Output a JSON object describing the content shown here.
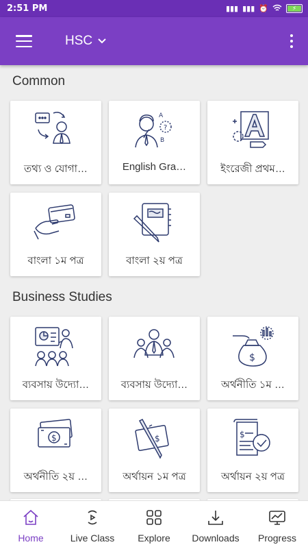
{
  "status_bar": {
    "time": "2:51 PM"
  },
  "appbar": {
    "title": "HSC"
  },
  "sections": [
    {
      "title": "Common",
      "cards": [
        {
          "label": "তথ্য ও যোগা…",
          "icon": "communication-icon"
        },
        {
          "label": "English Gra…",
          "icon": "thinking-person-icon"
        },
        {
          "label": "ইংরেজী প্রথম…",
          "icon": "letter-a-icon"
        },
        {
          "label": "বাংলা ১ম পত্র",
          "icon": "hand-card-icon"
        },
        {
          "label": "বাংলা ২য় পত্র",
          "icon": "notebook-pen-icon"
        }
      ]
    },
    {
      "title": "Business Studies",
      "cards": [
        {
          "label": "ব্যবসায় উদ্যো…",
          "icon": "presentation-icon"
        },
        {
          "label": "ব্যবসায় উদ্যো…",
          "icon": "team-icon"
        },
        {
          "label": "অর্থনীতি ১ম …",
          "icon": "money-bag-icon"
        },
        {
          "label": "অর্থনীতি ২য় …",
          "icon": "cash-icon"
        },
        {
          "label": "অর্থায়ন ১ম পত্র",
          "icon": "pen-money-icon"
        },
        {
          "label": "অর্থায়ন ২য় পত্র",
          "icon": "approved-document-icon"
        }
      ]
    }
  ],
  "bottom_nav": [
    {
      "label": "Home",
      "icon": "home-icon",
      "active": true
    },
    {
      "label": "Live Class",
      "icon": "live-icon"
    },
    {
      "label": "Explore",
      "icon": "grid-icon"
    },
    {
      "label": "Downloads",
      "icon": "download-icon"
    },
    {
      "label": "Progress",
      "icon": "progress-icon"
    }
  ],
  "colors": {
    "primary": "#7b3fc4",
    "status_bar": "#6a2fb5",
    "background": "#eeeeee",
    "card": "#ffffff",
    "icon_stroke": "#2d3a6e"
  }
}
